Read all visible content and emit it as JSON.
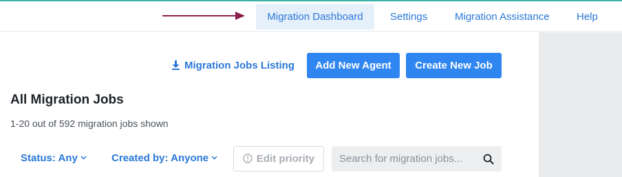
{
  "nav": {
    "items": [
      {
        "label": "Migration Dashboard",
        "active": true
      },
      {
        "label": "Settings",
        "active": false
      },
      {
        "label": "Migration Assistance",
        "active": false
      },
      {
        "label": "Help",
        "active": false
      }
    ]
  },
  "actions": {
    "listing_link": "Migration Jobs Listing",
    "add_agent": "Add New Agent",
    "create_job": "Create New Job"
  },
  "main": {
    "title": "All Migration Jobs",
    "subtitle": "1-20 out of 592 migration jobs shown"
  },
  "filters": {
    "status": "Status: Any",
    "created_by": "Created by: Anyone",
    "edit_priority": "Edit priority",
    "search_placeholder": "Search for migration jobs..."
  },
  "colors": {
    "accent": "#2f86f0",
    "link": "#2a78d6",
    "arrow": "#8b1f4d",
    "top_line": "#3bb3a9"
  },
  "icons": {
    "listing_link": "download-icon",
    "edit_priority": "info-icon",
    "search": "search-icon",
    "annotation": "arrow-icon"
  }
}
